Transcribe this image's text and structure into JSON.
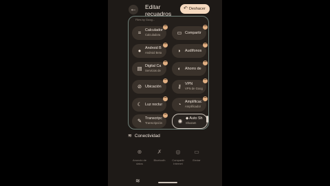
{
  "header": {
    "back_icon": "arrow-back-icon",
    "title": "Editar recuadros",
    "undo_icon": "undo-icon",
    "undo_label": "Deshacer"
  },
  "partial_top_label": "Files by Goog...",
  "tiles": [
    {
      "label": "Calculador",
      "sub": "Calculadora",
      "icon": "calculator-icon"
    },
    {
      "label": "Compartir",
      "sub": "",
      "icon": "share-icon"
    },
    {
      "label": "Android B",
      "sub": "Android Beta",
      "icon": "circle-icon"
    },
    {
      "label": "Audífonos",
      "sub": "",
      "icon": "hearing-icon"
    },
    {
      "label": "Digital Ca",
      "sub": "Servicios de",
      "icon": "digital-wellbeing-icon"
    },
    {
      "label": "Ahorro de",
      "sub": "",
      "icon": "data-saver-icon"
    },
    {
      "label": "Ubicación",
      "sub": "",
      "icon": "location-off-icon"
    },
    {
      "label": "VPN",
      "sub": "VPN de Goog",
      "icon": "vpn-key-icon"
    },
    {
      "label": "Luz noctur",
      "sub": "",
      "icon": "night-light-icon"
    },
    {
      "label": "Amplificac",
      "sub": "Amplificador",
      "icon": "sound-amplifier-icon"
    },
    {
      "label": "Transcripc",
      "sub": "Transcripción",
      "icon": "live-transcribe-icon"
    },
    {
      "label": "Auto Sh",
      "sub": "Shazam",
      "icon": "shazam-icon"
    }
  ],
  "section": {
    "icon": "wifi-icon",
    "title": "Conectividad"
  },
  "available": [
    {
      "label": "Anuncio de datos",
      "icon": "data-icon"
    },
    {
      "label": "Bluetooth",
      "icon": "bluetooth-off-icon"
    },
    {
      "label": "Compartir Internet",
      "icon": "hotspot-icon"
    },
    {
      "label": "Enviar",
      "icon": "cast-icon"
    }
  ],
  "colors": {
    "background": "#1e1a17",
    "tile": "#3a322b",
    "accent": "#f5d9bf",
    "remove_badge": "#e2b083"
  }
}
